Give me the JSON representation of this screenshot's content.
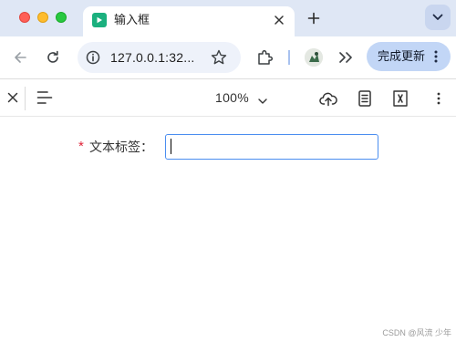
{
  "tab": {
    "title": "输入框",
    "favicon": "play-favicon-icon",
    "favicon_color": "#1bb07e"
  },
  "toolbar": {
    "url": "127.0.0.1:32...",
    "update_label": "完成更新"
  },
  "viewer": {
    "zoom": "100%"
  },
  "form": {
    "required_mark": "*",
    "label": "文本标签：",
    "input_value": "",
    "input_border_color": "#4b8ef0"
  },
  "watermark": "CSDN @风流 少年",
  "colors": {
    "tabstrip": "#dfe7f5",
    "update_button": "#c2d6f6",
    "required": "#e0253a"
  }
}
